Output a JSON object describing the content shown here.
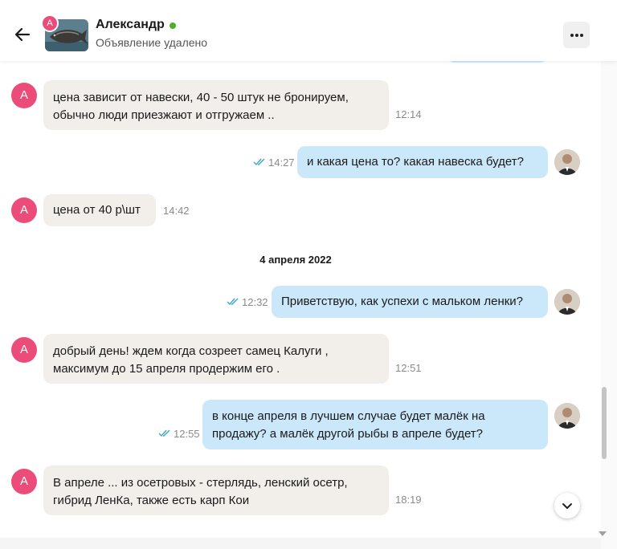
{
  "header": {
    "user_name": "Александр",
    "avatar_letter": "А",
    "ad_status": "Объявление удалено"
  },
  "accent_colors": {
    "incoming_avatar": "#ec4c79",
    "incoming_bubble": "#f2efea",
    "outgoing_bubble": "#cbe8fb",
    "online": "#4caf2b",
    "read_ticks": "#3aa6c9"
  },
  "icons": [
    "back-arrow-icon",
    "more-dots-icon",
    "double-check-icon",
    "chevron-down-icon"
  ],
  "messages": [
    {
      "direction": "in",
      "avatar": "А",
      "lines": [
        "цена зависит от навески, 40 - 50 штук не бронируем,",
        "обычно люди приезжают и отгружаем .."
      ],
      "time": "12:14"
    },
    {
      "direction": "out",
      "lines": [
        "и какая цена то? какая навеска будет?"
      ],
      "time": "14:27",
      "read": true
    },
    {
      "direction": "in",
      "avatar": "А",
      "lines": [
        "цена от 40 р\\шт"
      ],
      "time": "14:42"
    },
    {
      "direction": "out",
      "lines": [
        "Приветствую, как успехи с мальком ленки?"
      ],
      "time": "12:32",
      "read": true
    },
    {
      "direction": "in",
      "avatar": "А",
      "lines": [
        "добрый день! ждем когда созреет самец Калуги ,",
        "максимум до 15 апреля продержим его ."
      ],
      "time": "12:51"
    },
    {
      "direction": "out",
      "lines": [
        "в конце апреля в лучшем случае будет малёк на",
        "продажу? а малёк другой рыбы в апреле будет?"
      ],
      "time": "12:55",
      "read": true
    },
    {
      "direction": "in",
      "avatar": "А",
      "lines": [
        "В апреле ... из осетровых -  стерлядь, ленский осетр,",
        "гибрид ЛенКа, также есть карп Кои"
      ],
      "time": "18:19"
    }
  ],
  "date_separator": "4 апреля 2022"
}
